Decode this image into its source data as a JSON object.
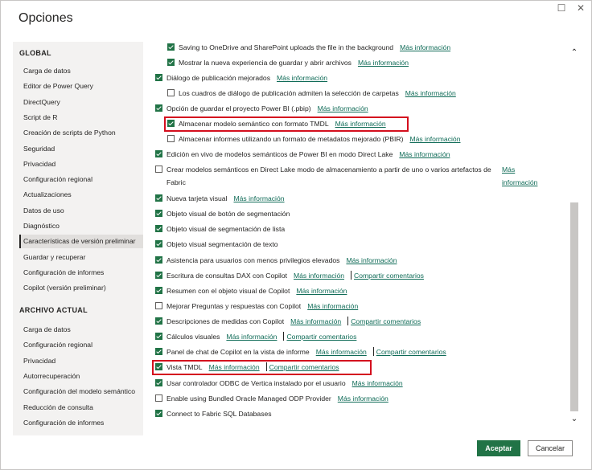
{
  "dialog": {
    "title": "Opciones",
    "restore_glyph": "☐",
    "close_glyph": "✕"
  },
  "sidebar": {
    "global_header": "GLOBAL",
    "global_items": [
      {
        "label": "Carga de datos"
      },
      {
        "label": "Editor de Power Query"
      },
      {
        "label": "DirectQuery"
      },
      {
        "label": "Script de R"
      },
      {
        "label": "Creación de scripts de Python"
      },
      {
        "label": "Seguridad"
      },
      {
        "label": "Privacidad"
      },
      {
        "label": "Configuración regional"
      },
      {
        "label": "Actualizaciones"
      },
      {
        "label": "Datos de uso"
      },
      {
        "label": "Diagnóstico"
      },
      {
        "label": "Características de versión preliminar",
        "selected": true
      },
      {
        "label": "Guardar y recuperar"
      },
      {
        "label": "Configuración de informes"
      },
      {
        "label": "Copilot (versión preliminar)"
      }
    ],
    "current_header": "ARCHIVO ACTUAL",
    "current_items": [
      {
        "label": "Carga de datos"
      },
      {
        "label": "Configuración regional"
      },
      {
        "label": "Privacidad"
      },
      {
        "label": "Autorrecuperación"
      },
      {
        "label": "Configuración del modelo semántico"
      },
      {
        "label": "Reducción de consulta"
      },
      {
        "label": "Configuración de informes"
      }
    ]
  },
  "features": {
    "info_link": "Más información",
    "feedback_link": "Compartir comentarios",
    "items": [
      {
        "label": "Saving to OneDrive and SharePoint uploads the file in the background",
        "checked": true,
        "indent": 1,
        "info": true
      },
      {
        "label": "Mostrar la nueva experiencia de guardar y abrir archivos",
        "checked": true,
        "indent": 1,
        "info": true
      },
      {
        "label": "Diálogo de publicación mejorados",
        "checked": true,
        "indent": 0,
        "info": true
      },
      {
        "label": "Los cuadros de diálogo de publicación admiten la selección de carpetas",
        "checked": false,
        "indent": 1,
        "info": true
      },
      {
        "label": "Opción de guardar el proyecto Power BI (.pbip)",
        "checked": true,
        "indent": 0,
        "info": true
      },
      {
        "label": "Almacenar modelo semántico con formato TMDL",
        "checked": true,
        "indent": 1,
        "info": true,
        "highlight": true
      },
      {
        "label": "Almacenar informes utilizando un formato de metadatos mejorado (PBIR)",
        "checked": false,
        "indent": 1,
        "info": true
      },
      {
        "label": "Edición en vivo de modelos semánticos de Power BI en modo Direct Lake",
        "checked": true,
        "indent": 0,
        "info": true
      },
      {
        "label": "Crear modelos semánticos en Direct Lake modo de almacenamiento a partir de uno o varios artefactos de",
        "label2": "Fabric",
        "info_line1": "Más",
        "info_line2": "información",
        "checked": false,
        "indent": 0,
        "wrap": true
      },
      {
        "label": "Nueva tarjeta visual",
        "checked": true,
        "indent": 0,
        "info": true
      },
      {
        "label": "Objeto visual de botón de segmentación",
        "checked": true,
        "indent": 0
      },
      {
        "label": "Objeto visual de segmentación de lista",
        "checked": true,
        "indent": 0
      },
      {
        "label": "Objeto visual segmentación de texto",
        "checked": true,
        "indent": 0
      },
      {
        "label": "Asistencia para usuarios con menos privilegios elevados",
        "checked": true,
        "indent": 0,
        "info": true
      },
      {
        "label": "Escritura de consultas DAX con Copilot",
        "checked": true,
        "indent": 0,
        "info": true,
        "feedback": true
      },
      {
        "label": "Resumen con el objeto visual de Copilot",
        "checked": true,
        "indent": 0,
        "info": true
      },
      {
        "label": "Mejorar Preguntas y respuestas con Copilot",
        "checked": false,
        "indent": 0,
        "info": true
      },
      {
        "label": "Descripciones de medidas con Copilot",
        "checked": true,
        "indent": 0,
        "info": true,
        "feedback": true
      },
      {
        "label": "Cálculos visuales",
        "checked": true,
        "indent": 0,
        "info": true,
        "feedback": true
      },
      {
        "label": "Panel de chat de Copilot en la vista de informe",
        "checked": true,
        "indent": 0,
        "info": true,
        "feedback": true
      },
      {
        "label": "Vista TMDL",
        "checked": true,
        "indent": 0,
        "info": true,
        "feedback": true,
        "highlight": true
      },
      {
        "label": "Usar controlador ODBC de Vertica instalado por el usuario",
        "checked": true,
        "indent": 0,
        "info": true
      },
      {
        "label": "Enable using Bundled Oracle Managed ODP Provider",
        "checked": false,
        "indent": 0,
        "info": true
      },
      {
        "label": "Connect to Fabric SQL Databases",
        "checked": true,
        "indent": 0
      }
    ]
  },
  "scrollbar": {
    "up": "⌃",
    "down": "⌄"
  },
  "buttons": {
    "accept": "Aceptar",
    "cancel": "Cancelar"
  }
}
